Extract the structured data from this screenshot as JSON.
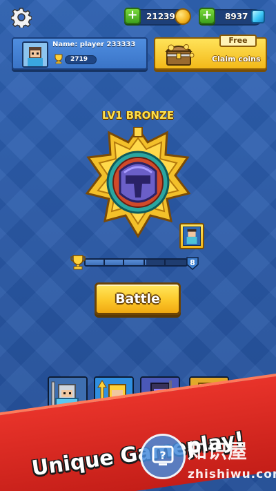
{
  "top_bar": {
    "coins": "21239",
    "gems": "8937",
    "coin_icon": "coin-icon",
    "gem_icon": "gem-icon"
  },
  "profile": {
    "name_label": "Name: player 233333",
    "trophies": "2719"
  },
  "free_reward": {
    "tag": "Free",
    "action": "Claim coins"
  },
  "rank": {
    "title": "LV1 BRONZE",
    "progress_fraction": 0.6,
    "next_level": "8"
  },
  "battle": {
    "label": "Battle"
  },
  "cards": [
    {
      "icon": "knight-card-icon"
    },
    {
      "icon": "spearman-card-icon"
    },
    {
      "icon": "dark-knight-card-icon"
    },
    {
      "icon": "golden-hero-card-icon"
    }
  ],
  "banner": {
    "text": "Unique Gameplay!"
  },
  "watermark": {
    "title": "知识屋",
    "url": "zhishiwu.com"
  },
  "colors": {
    "background": "#2a5aa8",
    "accent_yellow": "#fcc82a",
    "banner_red": "#d8281f",
    "plus_green": "#4db323"
  }
}
